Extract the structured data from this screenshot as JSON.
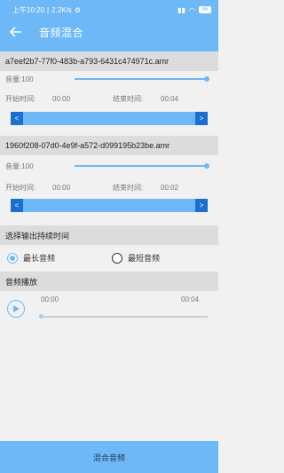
{
  "status_bar": {
    "time": "上午10:20",
    "net_speed": "2.2K/s",
    "battery": "46"
  },
  "header": {
    "title": "音频混合"
  },
  "tracks": [
    {
      "filename": "a7eef2b7-77f0-483b-a793-6431c474971c.amr",
      "volume_label": "音量:100",
      "volume_level": 100,
      "start_label": "开始时间:",
      "start_value": "00:00",
      "end_label": "结束时间:",
      "end_value": "00:04",
      "range_left": "<",
      "range_right": ">"
    },
    {
      "filename": "1960f208-07d0-4e9f-a572-d099195b23be.amr",
      "volume_label": "音量:100",
      "volume_level": 100,
      "start_label": "开始时间:",
      "start_value": "00:00",
      "end_label": "结束时间:",
      "end_value": "00:02",
      "range_left": "<",
      "range_right": ">"
    }
  ],
  "duration_section": {
    "title": "选择输出持续时间",
    "options": [
      {
        "label": "最长音频",
        "checked": true
      },
      {
        "label": "最短音频",
        "checked": false
      }
    ]
  },
  "playback": {
    "title": "音频播放",
    "current_time": "00:00",
    "total_time": "00:04",
    "progress": 0
  },
  "mix_button": {
    "label": "混合音频"
  },
  "colors": {
    "accent": "#6fb8f7",
    "handle": "#1a6fd0"
  }
}
